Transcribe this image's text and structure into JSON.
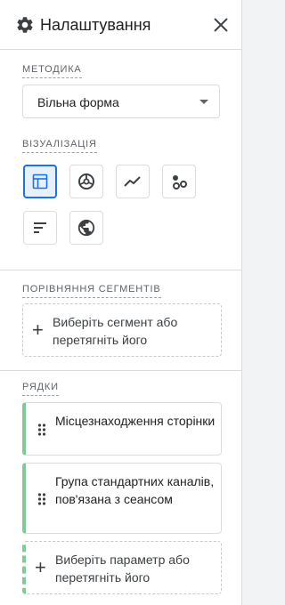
{
  "header": {
    "title": "Налаштування",
    "settings_icon": "gear-icon",
    "close_icon": "close-icon"
  },
  "technique": {
    "label": "МЕТОДИКА",
    "selected": "Вільна форма"
  },
  "visualization": {
    "label": "ВІЗУАЛІЗАЦІЯ",
    "buttons": [
      {
        "icon": "table-icon",
        "selected": true
      },
      {
        "icon": "donut-chart-icon",
        "selected": false
      },
      {
        "icon": "line-chart-icon",
        "selected": false
      },
      {
        "icon": "scatter-chart-icon",
        "selected": false
      },
      {
        "icon": "bar-chart-icon",
        "selected": false
      },
      {
        "icon": "globe-icon",
        "selected": false
      }
    ]
  },
  "segments": {
    "label": "ПОРІВНЯННЯ СЕГМЕНТІВ",
    "dropzone_text": "Виберіть сегмент або перетягніть його"
  },
  "rows": {
    "label": "РЯДКИ",
    "items": [
      {
        "text": "Місцезнаходження сторінки"
      },
      {
        "text": "Група стандартних каналів, пов'язана з сеансом"
      }
    ],
    "dropzone_text": "Виберіть параметр або перетягніть його"
  },
  "colors": {
    "accent": "#1a73e8",
    "chip_border": "#81c995",
    "text": "#202124",
    "muted": "#5f6368"
  }
}
